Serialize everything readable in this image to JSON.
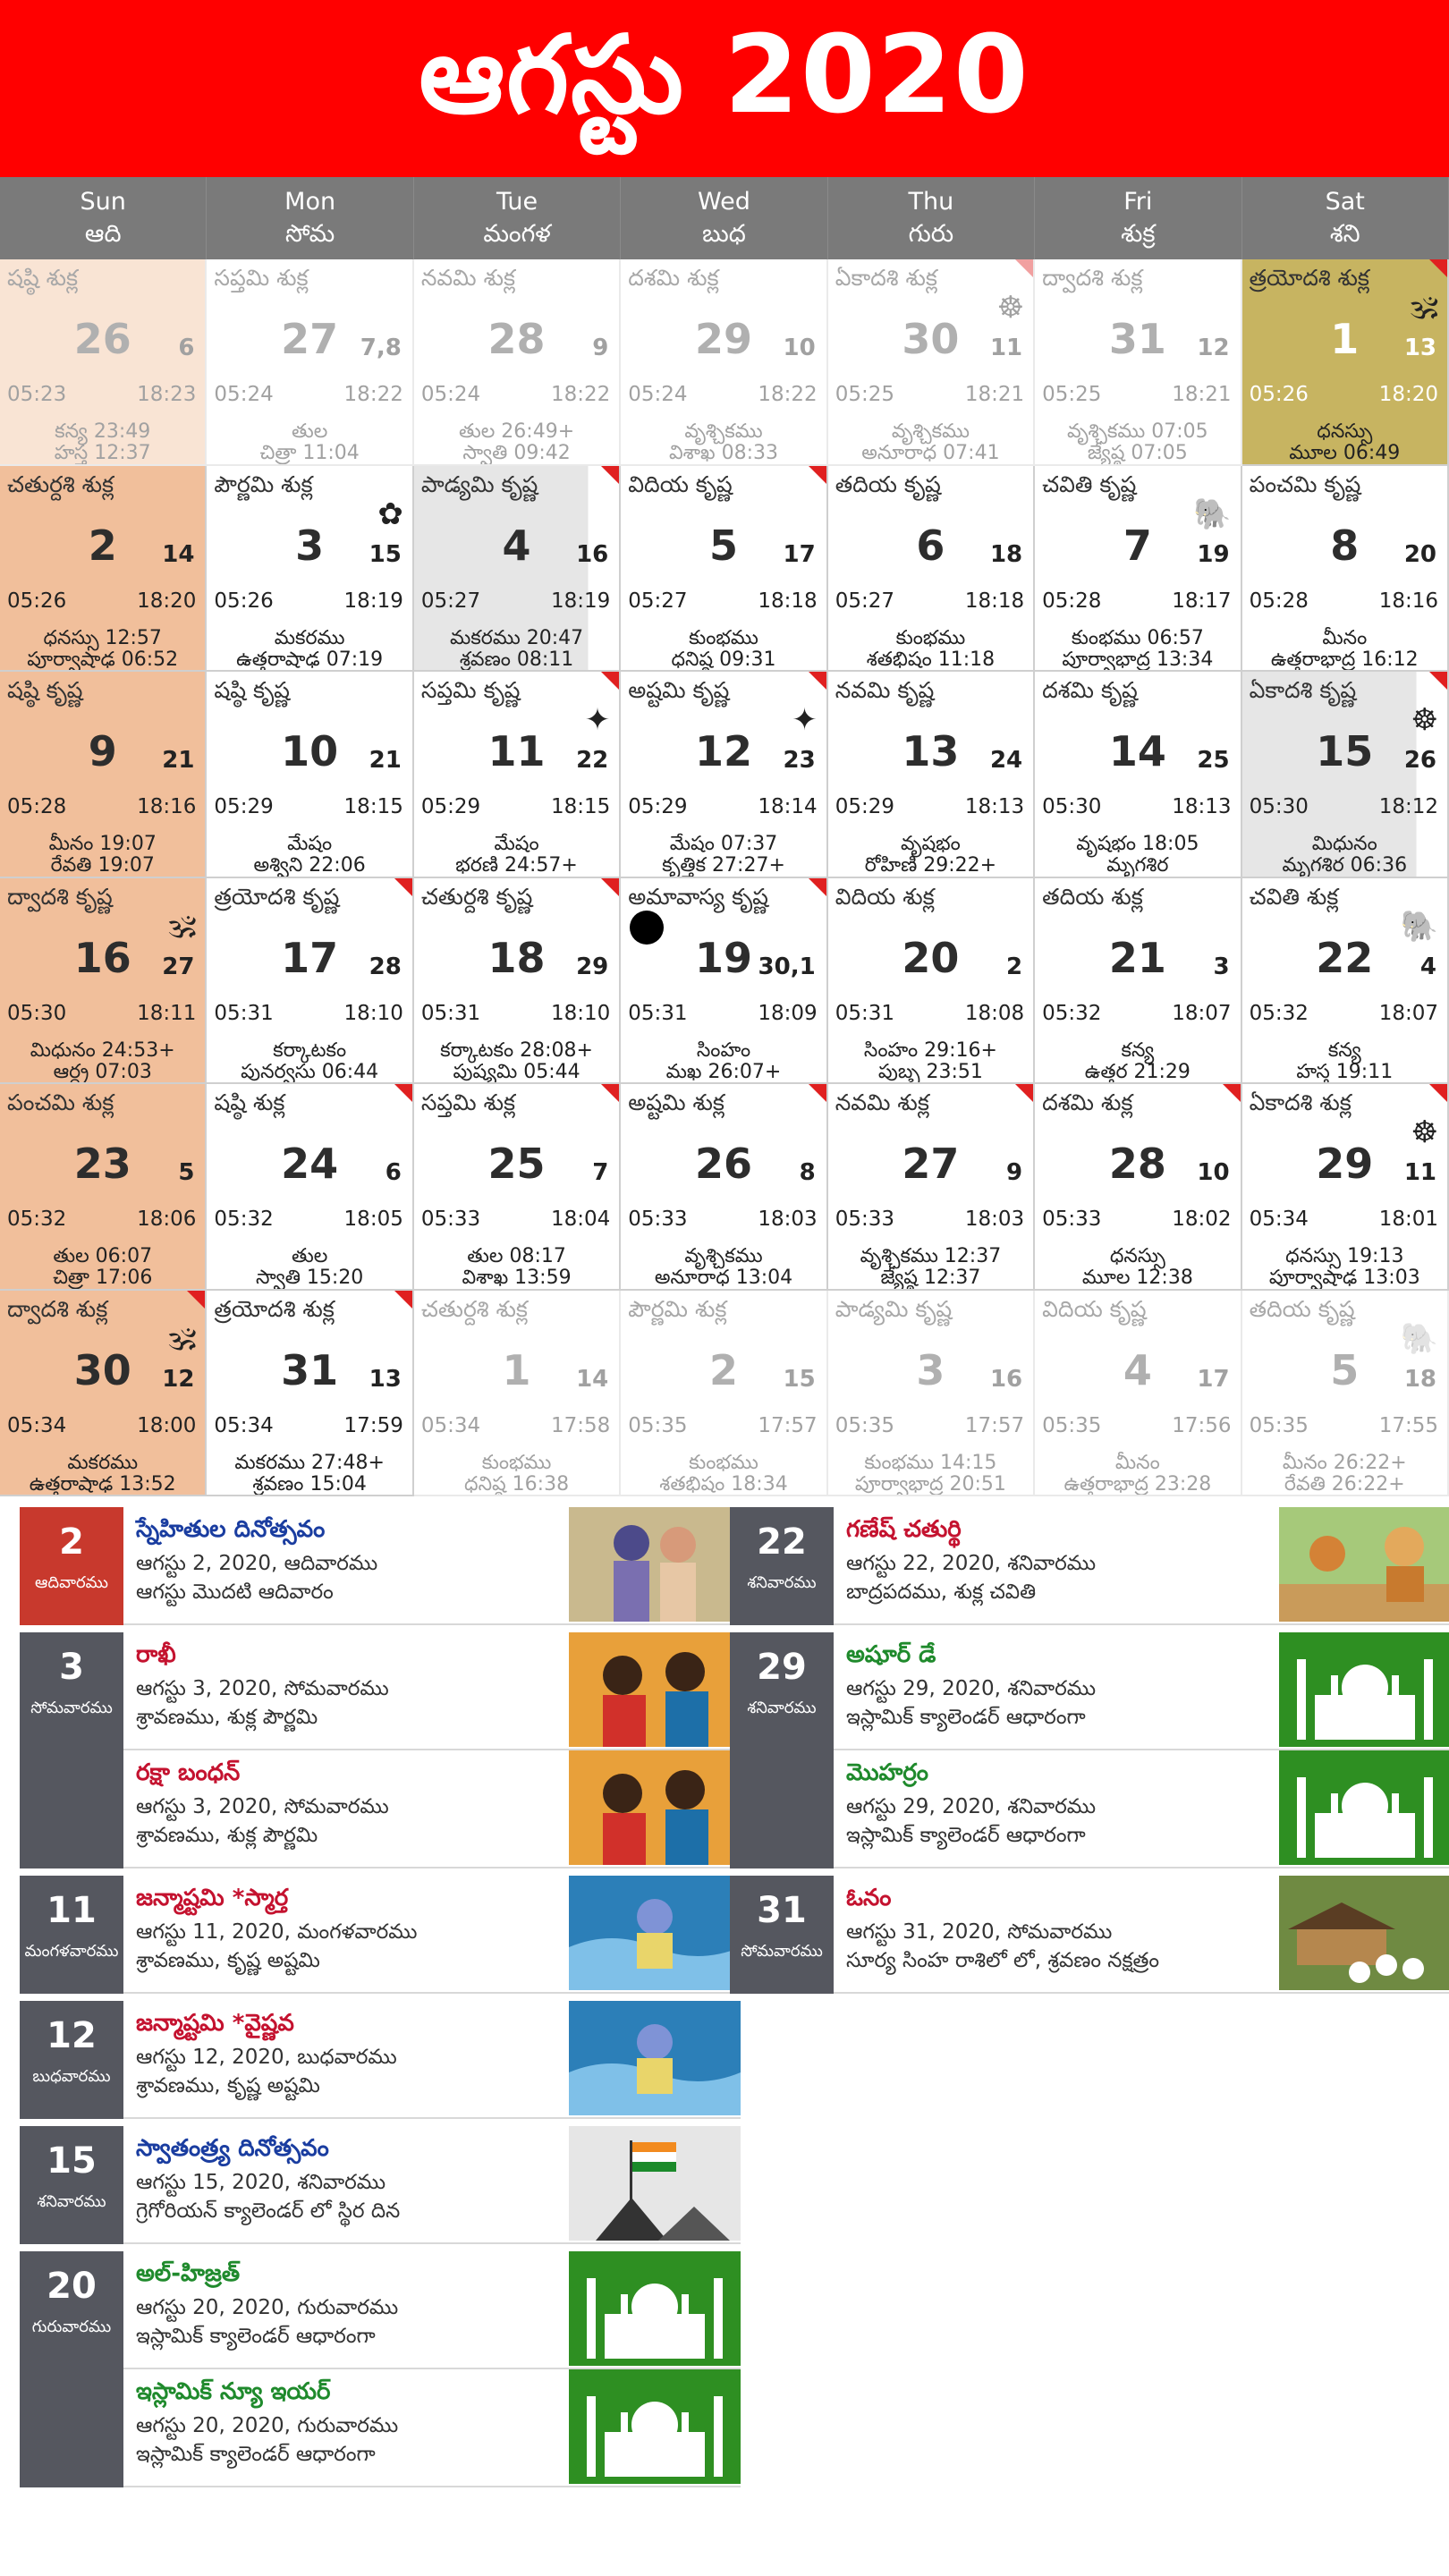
{
  "title": "ఆగస్టు 2020",
  "days": [
    {
      "en": "Sun",
      "te": "ఆది"
    },
    {
      "en": "Mon",
      "te": "సోమ"
    },
    {
      "en": "Tue",
      "te": "మంగళ"
    },
    {
      "en": "Wed",
      "te": "బుధ"
    },
    {
      "en": "Thu",
      "te": "గురు"
    },
    {
      "en": "Fri",
      "te": "శుక్ర"
    },
    {
      "en": "Sat",
      "te": "శని"
    }
  ],
  "cells": [
    {
      "tithi": "షష్ఠి శుక్ల",
      "date": "26",
      "sub": "6",
      "rise": "05:23",
      "set": "18:23",
      "l1": "కన్య 23:49",
      "l2": "హస్త 12:37",
      "kind": "sun dim"
    },
    {
      "tithi": "సప్తమి శుక్ల",
      "date": "27",
      "sub": "7,8",
      "rise": "05:24",
      "set": "18:22",
      "l1": "తుల",
      "l2": "చిత్రా 11:04",
      "kind": "dim"
    },
    {
      "tithi": "నవమి శుక్ల",
      "date": "28",
      "sub": "9",
      "rise": "05:24",
      "set": "18:22",
      "l1": "తుల 26:49+",
      "l2": "స్వాతి 09:42",
      "kind": "dim"
    },
    {
      "tithi": "దశమి శుక్ల",
      "date": "29",
      "sub": "10",
      "rise": "05:24",
      "set": "18:22",
      "l1": "వృశ్చికము",
      "l2": "విశాఖ 08:33",
      "kind": "dim"
    },
    {
      "tithi": "ఏకాదశి శుక్ల",
      "date": "30",
      "sub": "11",
      "rise": "05:25",
      "set": "18:21",
      "l1": "వృశ్చికము",
      "l2": "అనూరాధ 07:41",
      "kind": "dim",
      "flag": true,
      "icon": "☸"
    },
    {
      "tithi": "ద్వాదశి శుక్ల",
      "date": "31",
      "sub": "12",
      "rise": "05:25",
      "set": "18:21",
      "l1": "వృశ్చికము 07:05",
      "l2": "జ్యేష్ఠ 07:05",
      "kind": "dim"
    },
    {
      "tithi": "త్రయోదశి శుక్ల",
      "date": "1",
      "sub": "13",
      "rise": "05:26",
      "set": "18:20",
      "l1": "ధనస్సు",
      "l2": "మూల 06:49",
      "kind": "today",
      "flag": true,
      "icon": "🕉"
    },
    {
      "tithi": "చతుర్దశి శుక్ల",
      "date": "2",
      "sub": "14",
      "rise": "05:26",
      "set": "18:20",
      "l1": "ధనస్సు 12:57",
      "l2": "పూర్వాషాఢ 06:52",
      "kind": "sun"
    },
    {
      "tithi": "పౌర్ణమి శుక్ల",
      "date": "3",
      "sub": "15",
      "rise": "05:26",
      "set": "18:19",
      "l1": "మకరము",
      "l2": "ఉత్తరాషాఢ 07:19",
      "kind": "",
      "icon": "✿"
    },
    {
      "tithi": "పాడ్యమి కృష్ణ",
      "date": "4",
      "sub": "16",
      "rise": "05:27",
      "set": "18:19",
      "l1": "మకరము 20:47",
      "l2": "శ్రవణం 08:11",
      "kind": "shade",
      "flag": true
    },
    {
      "tithi": "విదియ కృష్ణ",
      "date": "5",
      "sub": "17",
      "rise": "05:27",
      "set": "18:18",
      "l1": "కుంభము",
      "l2": "ధనిష్ఠ 09:31",
      "kind": "",
      "flag": true
    },
    {
      "tithi": "తదియ కృష్ణ",
      "date": "6",
      "sub": "18",
      "rise": "05:27",
      "set": "18:18",
      "l1": "కుంభము",
      "l2": "శతభిషం 11:18",
      "kind": ""
    },
    {
      "tithi": "చవితి కృష్ణ",
      "date": "7",
      "sub": "19",
      "rise": "05:28",
      "set": "18:17",
      "l1": "కుంభము 06:57",
      "l2": "పూర్వాభాద్ర 13:34",
      "kind": "",
      "icon": "🐘"
    },
    {
      "tithi": "పంచమి కృష్ణ",
      "date": "8",
      "sub": "20",
      "rise": "05:28",
      "set": "18:16",
      "l1": "మీనం",
      "l2": "ఉత్తరాభాద్ర 16:12",
      "kind": ""
    },
    {
      "tithi": "షష్ఠి కృష్ణ",
      "date": "9",
      "sub": "21",
      "rise": "05:28",
      "set": "18:16",
      "l1": "మీనం 19:07",
      "l2": "రేవతి 19:07",
      "kind": "sun"
    },
    {
      "tithi": "షష్ఠి కృష్ణ",
      "date": "10",
      "sub": "21",
      "rise": "05:29",
      "set": "18:15",
      "l1": "మేషం",
      "l2": "అశ్విని 22:06",
      "kind": ""
    },
    {
      "tithi": "సప్తమి కృష్ణ",
      "date": "11",
      "sub": "22",
      "rise": "05:29",
      "set": "18:15",
      "l1": "మేషం",
      "l2": "భరణి 24:57+",
      "kind": "",
      "flag": true,
      "icon": "✦"
    },
    {
      "tithi": "అష్టమి కృష్ణ",
      "date": "12",
      "sub": "23",
      "rise": "05:29",
      "set": "18:14",
      "l1": "మేషం 07:37",
      "l2": "కృత్తిక 27:27+",
      "kind": "",
      "flag": true,
      "icon": "✦"
    },
    {
      "tithi": "నవమి కృష్ణ",
      "date": "13",
      "sub": "24",
      "rise": "05:29",
      "set": "18:13",
      "l1": "వృషభం",
      "l2": "రోహిణి 29:22+",
      "kind": ""
    },
    {
      "tithi": "దశమి కృష్ణ",
      "date": "14",
      "sub": "25",
      "rise": "05:30",
      "set": "18:13",
      "l1": "వృషభం 18:05",
      "l2": "మృగశిర",
      "kind": ""
    },
    {
      "tithi": "ఏకాదశి కృష్ణ",
      "date": "15",
      "sub": "26",
      "rise": "05:30",
      "set": "18:12",
      "l1": "మిధునం",
      "l2": "మృగశిర 06:36",
      "kind": "shade",
      "flag": true,
      "icon": "☸"
    },
    {
      "tithi": "ద్వాదశి కృష్ణ",
      "date": "16",
      "sub": "27",
      "rise": "05:30",
      "set": "18:11",
      "l1": "మిధునం 24:53+",
      "l2": "ఆర్ద్ర 07:03",
      "kind": "sun",
      "icon": "🕉"
    },
    {
      "tithi": "త్రయోదశి కృష్ణ",
      "date": "17",
      "sub": "28",
      "rise": "05:31",
      "set": "18:10",
      "l1": "కర్కాటకం",
      "l2": "పునర్వసు 06:44",
      "kind": "",
      "flag": true
    },
    {
      "tithi": "చతుర్దశి కృష్ణ",
      "date": "18",
      "sub": "29",
      "rise": "05:31",
      "set": "18:10",
      "l1": "కర్కాటకం 28:08+",
      "l2": "పుష్యమి 05:44",
      "kind": "",
      "flag": true
    },
    {
      "tithi": "అమావాస్య కృష్ణ",
      "date": "19",
      "sub": "30,1",
      "rise": "05:31",
      "set": "18:09",
      "l1": "సింహం",
      "l2": "మఖ 26:07+",
      "kind": "",
      "flag": true,
      "newmoon": true
    },
    {
      "tithi": "విదియ శుక్ల",
      "date": "20",
      "sub": "2",
      "rise": "05:31",
      "set": "18:08",
      "l1": "సింహం 29:16+",
      "l2": "పుబ్బ 23:51",
      "kind": ""
    },
    {
      "tithi": "తదియ శుక్ల",
      "date": "21",
      "sub": "3",
      "rise": "05:32",
      "set": "18:07",
      "l1": "కన్య",
      "l2": "ఉత్తర 21:29",
      "kind": ""
    },
    {
      "tithi": "చవితి శుక్ల",
      "date": "22",
      "sub": "4",
      "rise": "05:32",
      "set": "18:07",
      "l1": "కన్య",
      "l2": "హస్త 19:11",
      "kind": "",
      "icon": "🐘"
    },
    {
      "tithi": "పంచమి శుక్ల",
      "date": "23",
      "sub": "5",
      "rise": "05:32",
      "set": "18:06",
      "l1": "తుల 06:07",
      "l2": "చిత్రా 17:06",
      "kind": "sun"
    },
    {
      "tithi": "షష్ఠి శుక్ల",
      "date": "24",
      "sub": "6",
      "rise": "05:32",
      "set": "18:05",
      "l1": "తుల",
      "l2": "స్వాతి 15:20",
      "kind": "",
      "flag": true
    },
    {
      "tithi": "సప్తమి శుక్ల",
      "date": "25",
      "sub": "7",
      "rise": "05:33",
      "set": "18:04",
      "l1": "తుల 08:17",
      "l2": "విశాఖ 13:59",
      "kind": "",
      "flag": true
    },
    {
      "tithi": "అష్టమి శుక్ల",
      "date": "26",
      "sub": "8",
      "rise": "05:33",
      "set": "18:03",
      "l1": "వృశ్చికము",
      "l2": "అనూరాధ 13:04",
      "kind": "",
      "flag": true
    },
    {
      "tithi": "నవమి శుక్ల",
      "date": "27",
      "sub": "9",
      "rise": "05:33",
      "set": "18:03",
      "l1": "వృశ్చికము 12:37",
      "l2": "జ్యేష్ఠ 12:37",
      "kind": "",
      "flag": true
    },
    {
      "tithi": "దశమి శుక్ల",
      "date": "28",
      "sub": "10",
      "rise": "05:33",
      "set": "18:02",
      "l1": "ధనస్సు",
      "l2": "మూల 12:38",
      "kind": "",
      "flag": true
    },
    {
      "tithi": "ఏకాదశి శుక్ల",
      "date": "29",
      "sub": "11",
      "rise": "05:34",
      "set": "18:01",
      "l1": "ధనస్సు 19:13",
      "l2": "పూర్వాషాఢ 13:03",
      "kind": "",
      "flag": true,
      "icon": "☸"
    },
    {
      "tithi": "ద్వాదశి శుక్ల",
      "date": "30",
      "sub": "12",
      "rise": "05:34",
      "set": "18:00",
      "l1": "మకరము",
      "l2": "ఉత్తరాషాఢ 13:52",
      "kind": "sun",
      "flag": true,
      "icon": "🕉"
    },
    {
      "tithi": "త్రయోదశి శుక్ల",
      "date": "31",
      "sub": "13",
      "rise": "05:34",
      "set": "17:59",
      "l1": "మకరము 27:48+",
      "l2": "శ్రవణం 15:04",
      "kind": "",
      "flag": true
    },
    {
      "tithi": "చతుర్దశి శుక్ల",
      "date": "1",
      "sub": "14",
      "rise": "05:34",
      "set": "17:58",
      "l1": "కుంభము",
      "l2": "ధనిష్ఠ 16:38",
      "kind": "dim"
    },
    {
      "tithi": "పౌర్ణమి శుక్ల",
      "date": "2",
      "sub": "15",
      "rise": "05:35",
      "set": "17:57",
      "l1": "కుంభము",
      "l2": "శతభిషం 18:34",
      "kind": "dim"
    },
    {
      "tithi": "పాడ్యమి కృష్ణ",
      "date": "3",
      "sub": "16",
      "rise": "05:35",
      "set": "17:57",
      "l1": "కుంభము 14:15",
      "l2": "పూర్వాభాద్ర 20:51",
      "kind": "dim"
    },
    {
      "tithi": "విదియ కృష్ణ",
      "date": "4",
      "sub": "17",
      "rise": "05:35",
      "set": "17:56",
      "l1": "మీనం",
      "l2": "ఉత్తరాభాద్ర 23:28",
      "kind": "dim"
    },
    {
      "tithi": "తదియ కృష్ణ",
      "date": "5",
      "sub": "18",
      "rise": "05:35",
      "set": "17:55",
      "l1": "మీనం 26:22+",
      "l2": "రేవతి 26:22+",
      "kind": "dim",
      "icon": "🐘"
    }
  ],
  "festivals_left": [
    {
      "num": "2",
      "day": "ఆదివారము",
      "red": true,
      "items": [
        {
          "name": "స్నేహితుల దినోత్సవం",
          "color": "#1a3da0",
          "date": "ఆగస్టు 2, 2020, ఆదివారము",
          "desc": "ఆగస్టు మొదటి ఆదివారం",
          "thumb": "friends"
        }
      ]
    },
    {
      "num": "3",
      "day": "సోమవారము",
      "items": [
        {
          "name": "రాఖీ",
          "color": "#c4122f",
          "date": "ఆగస్టు 3, 2020, సోమవారము",
          "desc": "శ్రావణము, శుక్ల పౌర్ణమి",
          "thumb": "rakhi"
        },
        {
          "name": "రక్షా బంధన్",
          "color": "#c4122f",
          "date": "ఆగస్టు 3, 2020, సోమవారము",
          "desc": "శ్రావణము, శుక్ల పౌర్ణమి",
          "thumb": "rakhi"
        }
      ]
    },
    {
      "num": "11",
      "day": "మంగళవారము",
      "items": [
        {
          "name": "జన్మాష్టమి *స్మార్త",
          "color": "#c4122f",
          "date": "ఆగస్టు 11, 2020, మంగళవారము",
          "desc": "శ్రావణము, కృష్ణ అష్టమి",
          "thumb": "krishna"
        }
      ]
    },
    {
      "num": "12",
      "day": "బుధవారము",
      "items": [
        {
          "name": "జన్మాష్టమి *వైష్ణవ",
          "color": "#c4122f",
          "date": "ఆగస్టు 12, 2020, బుధవారము",
          "desc": "శ్రావణము, కృష్ణ అష్టమి",
          "thumb": "krishna"
        }
      ]
    },
    {
      "num": "15",
      "day": "శనివారము",
      "items": [
        {
          "name": "స్వాతంత్ర్య దినోత్సవం",
          "color": "#1a3da0",
          "date": "ఆగస్టు 15, 2020, శనివారము",
          "desc": "గ్రెగోరియన్ క్యాలెండర్ లో స్థిర దిన",
          "thumb": "flag"
        }
      ]
    },
    {
      "num": "20",
      "day": "గురువారము",
      "items": [
        {
          "name": "అల్-హిజ్రత్",
          "color": "#1f8a2c",
          "date": "ఆగస్టు 20, 2020, గురువారము",
          "desc": "ఇస్లామిక్ క్యాలెండర్ ఆధారంగా",
          "thumb": "mosque"
        },
        {
          "name": "ఇస్లామిక్ న్యూ ఇయర్",
          "color": "#1f8a2c",
          "date": "ఆగస్టు 20, 2020, గురువారము",
          "desc": "ఇస్లామిక్ క్యాలెండర్ ఆధారంగా",
          "thumb": "mosque"
        }
      ]
    }
  ],
  "festivals_right": [
    {
      "num": "22",
      "day": "శనివారము",
      "items": [
        {
          "name": "గణేష్ చతుర్థి",
          "color": "#c4122f",
          "date": "ఆగస్టు 22, 2020, శనివారము",
          "desc": "బాద్రపదము, శుక్ల చవితి",
          "thumb": "ganesh"
        }
      ]
    },
    {
      "num": "29",
      "day": "శనివారము",
      "items": [
        {
          "name": "అషూర్ డే",
          "color": "#1f8a2c",
          "date": "ఆగస్టు 29, 2020, శనివారము",
          "desc": "ఇస్లామిక్ క్యాలెండర్ ఆధారంగా",
          "thumb": "mosque"
        },
        {
          "name": "మొహర్రం",
          "color": "#1f8a2c",
          "date": "ఆగస్టు 29, 2020, శనివారము",
          "desc": "ఇస్లామిక్ క్యాలెండర్ ఆధారంగా",
          "thumb": "mosque"
        }
      ]
    },
    {
      "num": "31",
      "day": "సోమవారము",
      "items": [
        {
          "name": "ఓనం",
          "color": "#c4122f",
          "date": "ఆగస్టు 31, 2020, సోమవారము",
          "desc": "సూర్య సింహ రాశిలో లో, శ్రవణం నక్షత్రం",
          "thumb": "onam"
        }
      ]
    }
  ]
}
